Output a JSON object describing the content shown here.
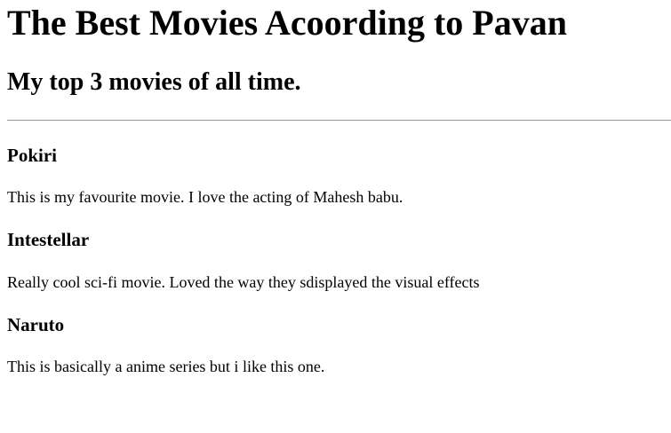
{
  "header": {
    "title": "The Best Movies Acoording to Pavan",
    "subtitle": "My top 3 movies of all time."
  },
  "movies": [
    {
      "title": "Pokiri",
      "description": "This is my favourite movie. I love the acting of Mahesh babu."
    },
    {
      "title": "Intestellar",
      "description": "Really cool sci-fi movie. Loved the way they sdisplayed the visual effects"
    },
    {
      "title": "Naruto",
      "description": "This is basically a anime series but i like this one."
    }
  ]
}
